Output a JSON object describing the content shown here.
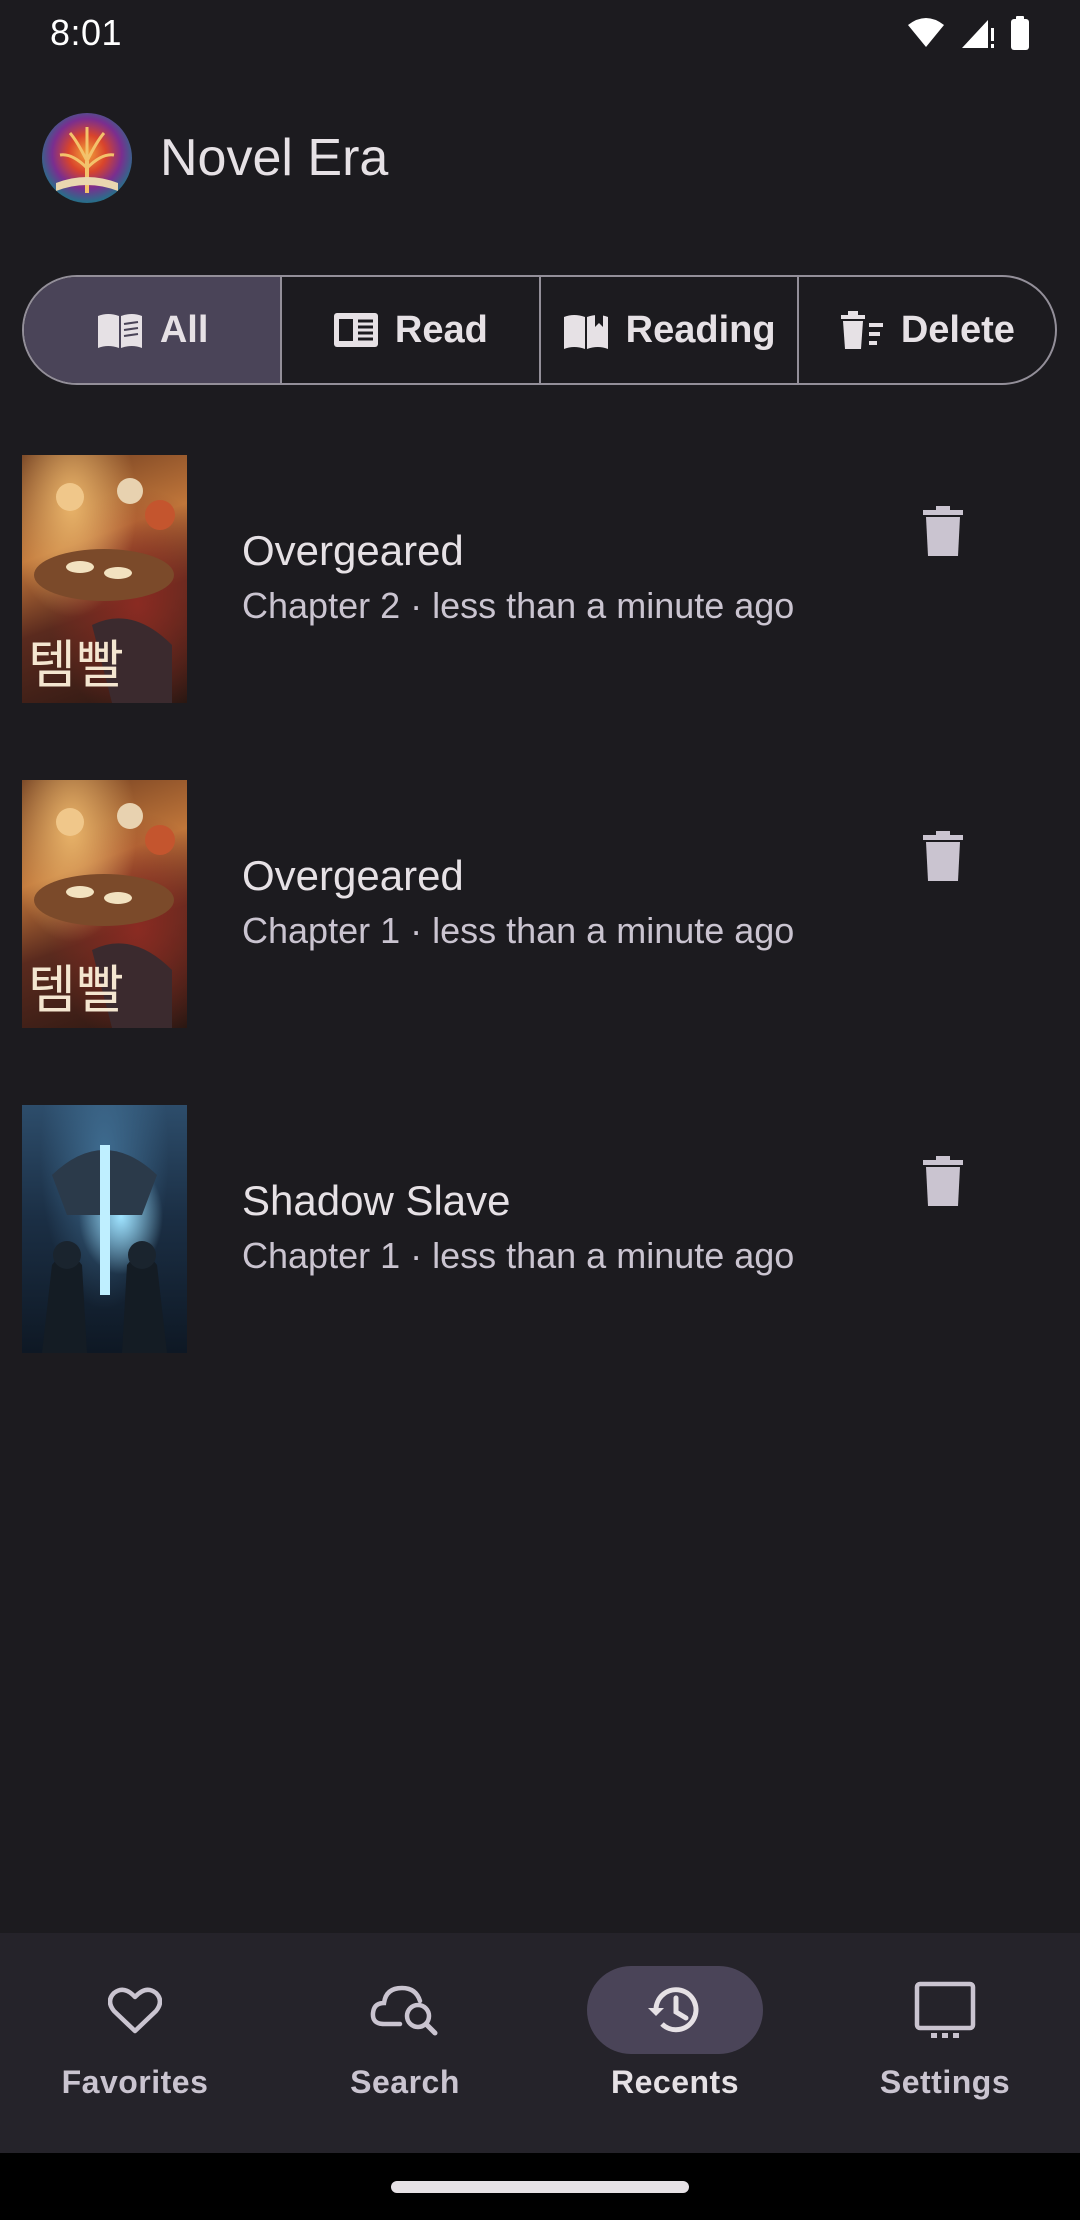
{
  "status_bar": {
    "time": "8:01"
  },
  "app": {
    "title": "Novel Era"
  },
  "filters": [
    {
      "label": "All",
      "icon": "open-book-icon",
      "selected": true
    },
    {
      "label": "Read",
      "icon": "newspaper-icon",
      "selected": false
    },
    {
      "label": "Reading",
      "icon": "reading-book-icon",
      "selected": false
    },
    {
      "label": "Delete",
      "icon": "delete-sweep-icon",
      "selected": false
    }
  ],
  "recents": [
    {
      "title": "Overgeared",
      "subtitle": "Chapter 2 · less than a minute ago",
      "cover": "overgeared-cover"
    },
    {
      "title": "Overgeared",
      "subtitle": "Chapter 1 · less than a minute ago",
      "cover": "overgeared-cover"
    },
    {
      "title": "Shadow Slave",
      "subtitle": "Chapter 1 · less than a minute ago",
      "cover": "shadow-slave-cover"
    }
  ],
  "bottom_nav": [
    {
      "label": "Favorites",
      "icon": "heart-icon",
      "active": false
    },
    {
      "label": "Search",
      "icon": "cloud-search-icon",
      "active": false
    },
    {
      "label": "Recents",
      "icon": "history-icon",
      "active": true
    },
    {
      "label": "Settings",
      "icon": "settings-window-icon",
      "active": false
    }
  ],
  "colors": {
    "background": "#1c1b1f",
    "surface_nav": "#25232a",
    "selected_container": "#4a4458",
    "outline": "#938f99",
    "on_surface": "#e6e1e5",
    "on_surface_variant": "#cac4d0"
  }
}
